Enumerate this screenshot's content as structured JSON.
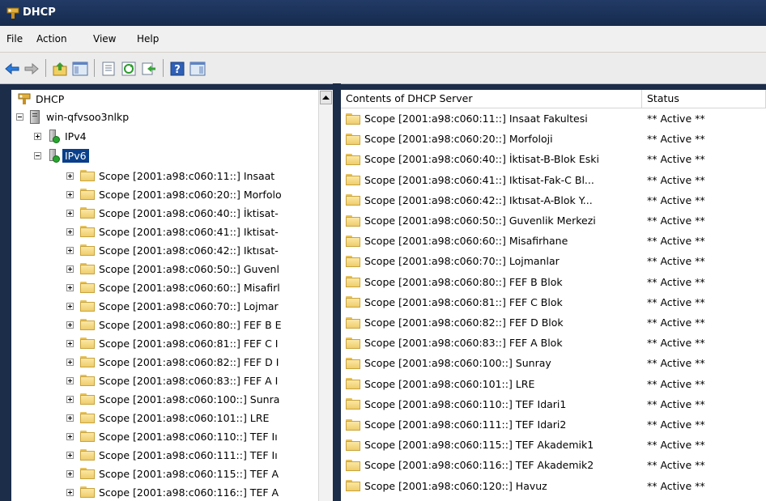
{
  "window": {
    "title": "DHCP"
  },
  "menu": [
    "File",
    "Action",
    "View",
    "Help"
  ],
  "toolbar": [
    "back-icon",
    "forward-icon",
    "up-level-icon",
    "show-hide-tree-icon",
    "properties-icon",
    "refresh-icon",
    "export-icon",
    "help-icon",
    "action-pane-icon"
  ],
  "tree": {
    "root": "DHCP",
    "server": "win-qfvsoo3nlkp",
    "ipv4": "IPv4",
    "ipv6": "IPv6",
    "scopes": [
      "Scope [2001:a98:c060:11::] Insaat",
      "Scope [2001:a98:c060:20::] Morfolo",
      "Scope [2001:a98:c060:40::] İktisat-",
      "Scope [2001:a98:c060:41::] Iktisat-",
      "Scope [2001:a98:c060:42::] Iktısat-",
      "Scope [2001:a98:c060:50::] Guvenl",
      "Scope [2001:a98:c060:60::] Misafirl",
      "Scope [2001:a98:c060:70::] Lojmar",
      "Scope [2001:a98:c060:80::] FEF B E",
      "Scope [2001:a98:c060:81::] FEF C I",
      "Scope [2001:a98:c060:82::] FEF D I",
      "Scope [2001:a98:c060:83::] FEF A I",
      "Scope [2001:a98:c060:100::] Sunra",
      "Scope [2001:a98:c060:101::] LRE",
      "Scope [2001:a98:c060:110::] TEF Iı",
      "Scope [2001:a98:c060:111::] TEF Iı",
      "Scope [2001:a98:c060:115::] TEF A",
      "Scope [2001:a98:c060:116::] TEF A"
    ]
  },
  "list": {
    "col_name": "Contents of DHCP Server",
    "col_status": "Status",
    "rows": [
      {
        "name": "Scope [2001:a98:c060:11::] Insaat Fakultesi",
        "status": "** Active **"
      },
      {
        "name": "Scope [2001:a98:c060:20::] Morfoloji",
        "status": "** Active **"
      },
      {
        "name": "Scope [2001:a98:c060:40::] İktisat-B-Blok Eski",
        "status": "** Active **"
      },
      {
        "name": "Scope [2001:a98:c060:41::] Iktisat-Fak-C Bl...",
        "status": "** Active **"
      },
      {
        "name": "Scope [2001:a98:c060:42::] Iktısat-A-Blok Y...",
        "status": "** Active **"
      },
      {
        "name": "Scope [2001:a98:c060:50::] Guvenlik Merkezi",
        "status": "** Active **"
      },
      {
        "name": "Scope [2001:a98:c060:60::] Misafirhane",
        "status": "** Active **"
      },
      {
        "name": "Scope [2001:a98:c060:70::] Lojmanlar",
        "status": "** Active **"
      },
      {
        "name": "Scope [2001:a98:c060:80::] FEF B Blok",
        "status": "** Active **"
      },
      {
        "name": "Scope [2001:a98:c060:81::] FEF C Blok",
        "status": "** Active **"
      },
      {
        "name": "Scope [2001:a98:c060:82::] FEF D Blok",
        "status": "** Active **"
      },
      {
        "name": "Scope [2001:a98:c060:83::] FEF A Blok",
        "status": "** Active **"
      },
      {
        "name": "Scope [2001:a98:c060:100::] Sunray",
        "status": "** Active **"
      },
      {
        "name": "Scope [2001:a98:c060:101::] LRE",
        "status": "** Active **"
      },
      {
        "name": "Scope [2001:a98:c060:110::] TEF Idari1",
        "status": "** Active **"
      },
      {
        "name": "Scope [2001:a98:c060:111::] TEF Idari2",
        "status": "** Active **"
      },
      {
        "name": "Scope [2001:a98:c060:115::] TEF Akademik1",
        "status": "** Active **"
      },
      {
        "name": "Scope [2001:a98:c060:116::] TEF Akademik2",
        "status": "** Active **"
      },
      {
        "name": "Scope [2001:a98:c060:120::] Havuz",
        "status": "** Active **"
      }
    ]
  }
}
